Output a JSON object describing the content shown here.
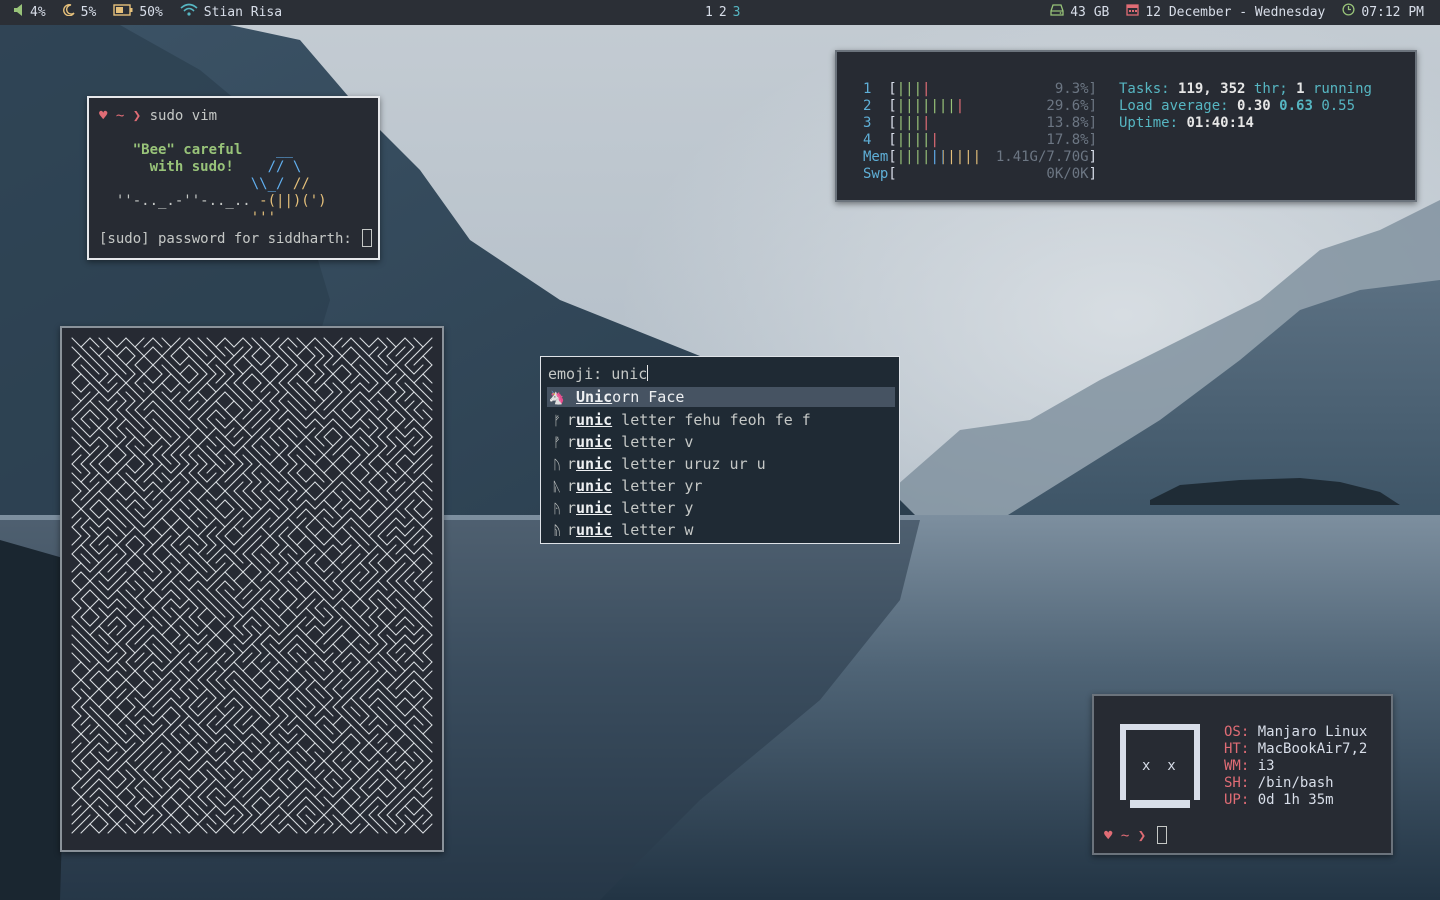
{
  "statusbar": {
    "volume": "4%",
    "night": "5%",
    "battery": "50%",
    "wifi": "Stian Risa",
    "workspaces": [
      {
        "label": "1",
        "active": false
      },
      {
        "label": "2",
        "active": false
      },
      {
        "label": "3",
        "active": true
      }
    ],
    "disk": "43 GB",
    "date": "12 December - Wednesday",
    "time": "07:12 PM",
    "colors": {
      "volume": "#98c379",
      "night": "#e5c07b",
      "battery": "#e5c07b",
      "wifi": "#56b6c2",
      "disk": "#98c379",
      "date": "#e06c75",
      "time": "#98c379"
    }
  },
  "sudo_terminal": {
    "prompt_heart": "♥",
    "prompt_tilde": "~",
    "prompt_arrow": "❯",
    "command": "sudo vim",
    "bee_line1": "\"Bee\" careful",
    "bee_line2": "with sudo!",
    "art1": "__",
    "art2": "// \\",
    "art3a": "\\\\_/",
    "art3b": "//",
    "art4a": "''-.._.-''-.._..",
    "art4b": "-(||)(')",
    "art5": "'''",
    "password_prompt": "[sudo] password for siddharth:"
  },
  "htop": {
    "cpus": [
      {
        "id": "1",
        "green": "|||",
        "red": "|",
        "pct": "9.3%]"
      },
      {
        "id": "2",
        "green": "|||||||",
        "red": "|",
        "pct": "29.6%]"
      },
      {
        "id": "3",
        "green": "|||",
        "red": "|",
        "pct": "13.8%]"
      },
      {
        "id": "4",
        "green": "||||",
        "red": "|",
        "pct": "17.8%]"
      }
    ],
    "mem_label": "Mem",
    "mem_bar": "||||||||||",
    "mem_value": "1.41G/7.70G",
    "swp_label": "Swp",
    "swp_value": "0K/0K",
    "tasks_label": "Tasks:",
    "tasks_count": "119,",
    "threads": "352",
    "thr_label": "thr;",
    "running_count": "1",
    "running_label": "running",
    "load_label": "Load average:",
    "load1": "0.30",
    "load5": "0.63",
    "load15": "0.55",
    "uptime_label": "Uptime:",
    "uptime": "01:40:14"
  },
  "rofi": {
    "prompt": "emoji:",
    "query": "unic",
    "items": [
      {
        "icon": "unicorn-icon",
        "glyph": "🦄",
        "pre": "",
        "match": "Unic",
        "post": "orn Face",
        "selected": true
      },
      {
        "icon": "rune-fehu-icon",
        "glyph": "ᚠ",
        "pre": "r",
        "match": "unic",
        "post": " letter fehu feoh fe f",
        "selected": false
      },
      {
        "icon": "rune-v-icon",
        "glyph": "ᚡ",
        "pre": "r",
        "match": "unic",
        "post": " letter v",
        "selected": false
      },
      {
        "icon": "rune-uruz-icon",
        "glyph": "ᚢ",
        "pre": "r",
        "match": "unic",
        "post": " letter uruz ur u",
        "selected": false
      },
      {
        "icon": "rune-yr-icon",
        "glyph": "ᚣ",
        "pre": "r",
        "match": "unic",
        "post": " letter yr",
        "selected": false
      },
      {
        "icon": "rune-y-icon",
        "glyph": "ᚤ",
        "pre": "r",
        "match": "unic",
        "post": " letter y",
        "selected": false
      },
      {
        "icon": "rune-w-icon",
        "glyph": "ᚥ",
        "pre": "r",
        "match": "unic",
        "post": " letter w",
        "selected": false
      }
    ]
  },
  "neofetch": {
    "eyes": "x  x",
    "rows": [
      {
        "label": "OS:",
        "value": "Manjaro Linux"
      },
      {
        "label": "HT:",
        "value": "MacBookAir7,2"
      },
      {
        "label": "WM:",
        "value": "i3"
      },
      {
        "label": "SH:",
        "value": "/bin/bash"
      },
      {
        "label": "UP:",
        "value": "0d 1h 35m"
      }
    ],
    "prompt_heart": "♥",
    "prompt_tilde": "~",
    "prompt_arrow": "❯"
  }
}
